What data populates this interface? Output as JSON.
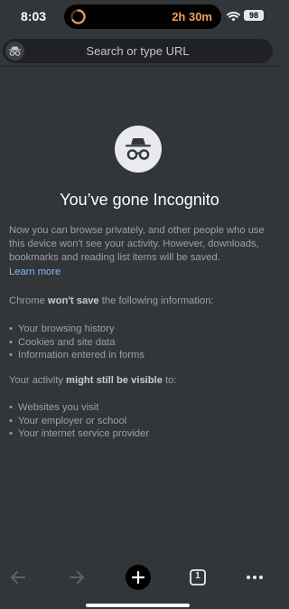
{
  "status_bar": {
    "time": "8:03",
    "island_timer": "2h 30m",
    "battery": "98",
    "icons": [
      "timer-icon",
      "wifi-icon",
      "battery-icon"
    ]
  },
  "toolbar": {
    "omnibox_placeholder": "Search or type URL",
    "badge_icon": "incognito-icon"
  },
  "incognito": {
    "icon": "incognito-icon",
    "title": "You’ve gone Incognito",
    "intro": "Now you can browse privately, and other people who use this device won't see your activity. However, downloads, bookmarks and reading list items will be saved.",
    "learn_more": "Learn more",
    "wont_save_prefix": "Chrome ",
    "wont_save_bold": "won't save",
    "wont_save_suffix": " the following information:",
    "wont_save_items": [
      "Your browsing history",
      "Cookies and site data",
      "Information entered in forms"
    ],
    "visible_prefix": "Your activity ",
    "visible_bold": "might still be visible",
    "visible_suffix": " to:",
    "visible_items": [
      "Websites you visit",
      "Your employer or school",
      "Your internet service provider"
    ],
    "bullet": "•"
  },
  "bottom_bar": {
    "tab_count": "1",
    "buttons": [
      "back-arrow-icon",
      "forward-arrow-icon",
      "new-tab-plus-icon",
      "tab-switcher-icon",
      "more-menu-icon"
    ]
  },
  "colors": {
    "background": "#323639",
    "link": "#8ab4f8",
    "text_muted": "#9aa0a6",
    "timer_orange": "#f0a05a"
  }
}
